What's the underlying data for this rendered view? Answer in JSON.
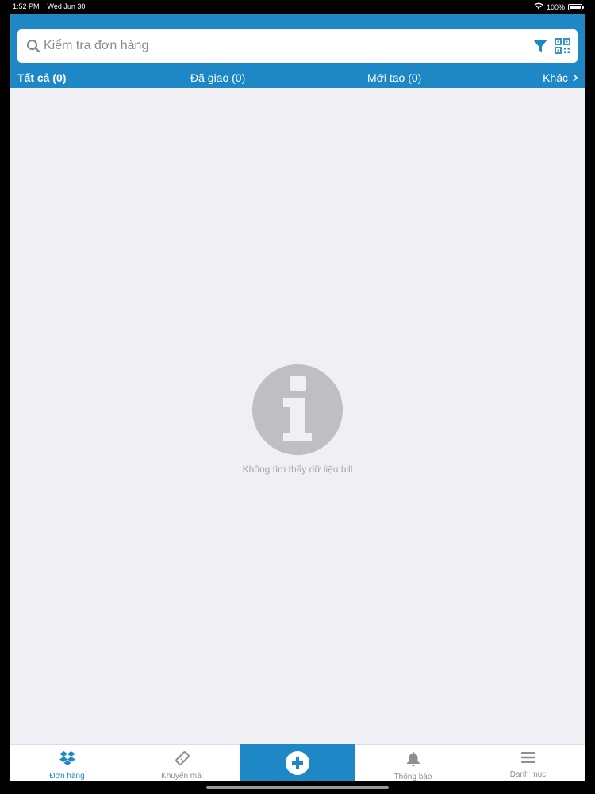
{
  "status_bar": {
    "time": "1:52 PM",
    "date": "Wed Jun 30",
    "battery": "100%"
  },
  "search": {
    "placeholder": "Kiểm tra đơn hàng",
    "value": ""
  },
  "tabs": [
    {
      "label": "Tất cả (0)",
      "active": true
    },
    {
      "label": "Đã giao (0)",
      "active": false
    },
    {
      "label": "Mới tạo (0)",
      "active": false
    },
    {
      "label": "Khác",
      "active": false
    }
  ],
  "empty_state": {
    "message": "Không tìm thấy dữ liệu bill"
  },
  "bottom_nav": [
    {
      "label": "Đơn hàng",
      "icon": "dropbox-icon",
      "active": true
    },
    {
      "label": "Khuyến mãi",
      "icon": "ticket-icon",
      "active": false
    },
    {
      "label": "",
      "icon": "plus-circle-icon",
      "active": false
    },
    {
      "label": "Thông báo",
      "icon": "bell-icon",
      "active": false
    },
    {
      "label": "Danh mục",
      "icon": "menu-icon",
      "active": false
    }
  ],
  "colors": {
    "brand": "#1e88c6",
    "background": "#efeff4",
    "empty_icon": "#bfbfc3"
  }
}
